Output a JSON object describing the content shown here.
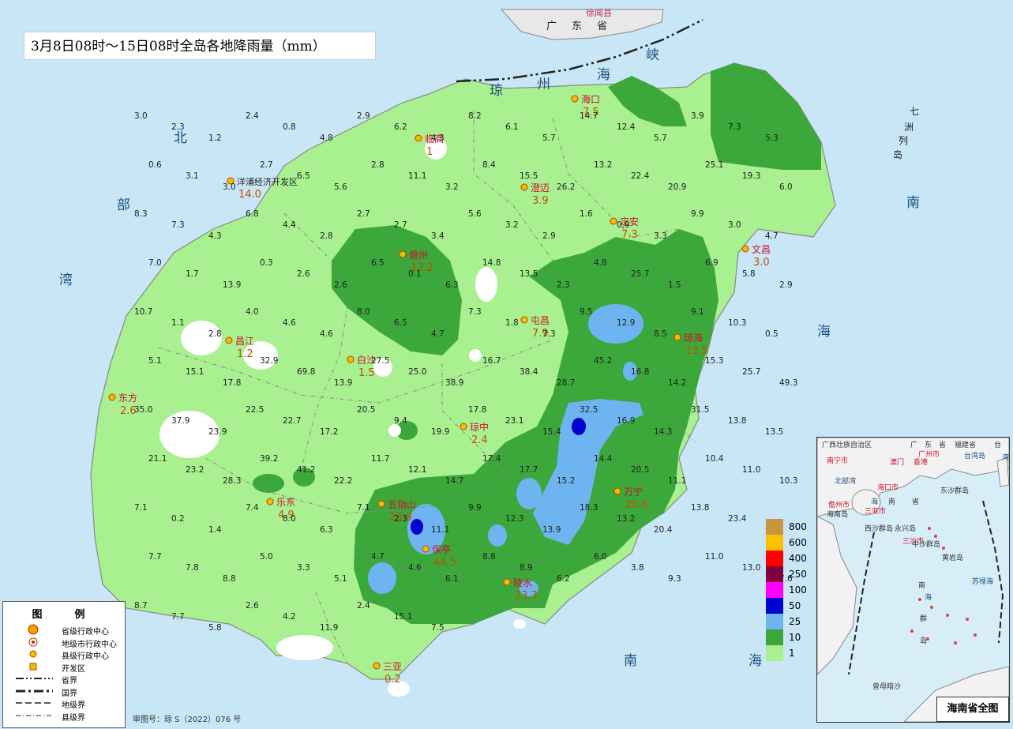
{
  "title": "3月8日08时～15日08时全岛各地降雨量（mm）",
  "approval": "审图号：琼 S（2022）076 号",
  "legend": {
    "title": "图　例",
    "items": [
      {
        "label": "省级行政中心",
        "symbol": "star-circle"
      },
      {
        "label": "地级市行政中心",
        "symbol": "double-circle"
      },
      {
        "label": "县级行政中心",
        "symbol": "dot-circle"
      },
      {
        "label": "开发区",
        "symbol": "square"
      },
      {
        "label": "省界",
        "symbol": "line-dashdot2"
      },
      {
        "label": "国界",
        "symbol": "line-thick"
      },
      {
        "label": "地级界",
        "symbol": "line-dash"
      },
      {
        "label": "县级界",
        "symbol": "line-dashdot"
      }
    ]
  },
  "color_scale": [
    {
      "label": "800",
      "color": "#c8963c"
    },
    {
      "label": "600",
      "color": "#ffc000"
    },
    {
      "label": "400",
      "color": "#ff0000"
    },
    {
      "label": "250",
      "color": "#800040"
    },
    {
      "label": "100",
      "color": "#ff00ff"
    },
    {
      "label": "50",
      "color": "#0000d0"
    },
    {
      "label": "25",
      "color": "#6eb4f0"
    },
    {
      "label": "10",
      "color": "#3ca83c"
    },
    {
      "label": "1",
      "color": "#a8f090"
    }
  ],
  "sea_labels": [
    "北",
    "部",
    "湾",
    "海",
    "南",
    "海",
    "南",
    "琼",
    "州",
    "海",
    "峡",
    "七",
    "洲",
    "列",
    "岛",
    "广",
    "东",
    "省",
    "徐闻县"
  ],
  "stations": [
    {
      "name": "海口",
      "value": "7.5"
    },
    {
      "name": "临高",
      "value": "1"
    },
    {
      "name": "澄迈",
      "value": "3.9"
    },
    {
      "name": "定安",
      "value": "7.3"
    },
    {
      "name": "文昌",
      "value": "3.0"
    },
    {
      "name": "儋州",
      "value": "17.2"
    },
    {
      "name": "洋浦经济开发区",
      "value": "14.0"
    },
    {
      "name": "昌江",
      "value": "1.2"
    },
    {
      "name": "白沙",
      "value": "1.5"
    },
    {
      "name": "屯昌",
      "value": "7.9"
    },
    {
      "name": "琼海",
      "value": "13.5"
    },
    {
      "name": "东方",
      "value": "2.6"
    },
    {
      "name": "琼中",
      "value": "2.4"
    },
    {
      "name": "乐东",
      "value": "4.9"
    },
    {
      "name": "五指山",
      "value": "23.8"
    },
    {
      "name": "万宁",
      "value": "20.6"
    },
    {
      "name": "保亭",
      "value": "44.5"
    },
    {
      "name": "陵水",
      "value": "23.3"
    },
    {
      "name": "三亚",
      "value": "0.2"
    }
  ],
  "point_values": [
    "3.0",
    "2.3",
    "1.2",
    "2.4",
    "0.8",
    "4.8",
    "2.9",
    "6.2",
    "4.3",
    "8.2",
    "6.1",
    "5.7",
    "14.7",
    "12.4",
    "5.7",
    "3.9",
    "7.3",
    "5.3",
    "0.6",
    "3.1",
    "3.0",
    "2.7",
    "6.5",
    "5.6",
    "2.8",
    "11.1",
    "3.2",
    "8.4",
    "15.5",
    "26.2",
    "13.2",
    "22.4",
    "20.9",
    "25.1",
    "19.3",
    "6.0",
    "8.3",
    "7.3",
    "4.3",
    "6.8",
    "4.4",
    "2.8",
    "2.7",
    "2.7",
    "3.4",
    "5.6",
    "3.2",
    "2.9",
    "1.6",
    "0.9",
    "3.3",
    "9.9",
    "3.0",
    "4.7",
    "7.0",
    "1.7",
    "13.9",
    "0.3",
    "2.6",
    "2.6",
    "6.5",
    "0.1",
    "6.3",
    "14.8",
    "13.5",
    "2.3",
    "4.8",
    "25.7",
    "1.5",
    "6.9",
    "5.8",
    "2.9",
    "10.7",
    "1.1",
    "2.8",
    "4.0",
    "4.6",
    "4.6",
    "8.0",
    "6.5",
    "4.7",
    "7.3",
    "1.8",
    "7.3",
    "9.5",
    "12.9",
    "8.5",
    "9.1",
    "10.3",
    "0.5",
    "5.1",
    "15.1",
    "17.8",
    "32.9",
    "69.8",
    "13.9",
    "27.5",
    "25.0",
    "38.9",
    "16.7",
    "38.4",
    "28.7",
    "45.2",
    "16.8",
    "14.2",
    "15.3",
    "25.7",
    "49.3",
    "35.0",
    "37.9",
    "23.9",
    "22.5",
    "22.7",
    "17.2",
    "20.5",
    "9.4",
    "19.9",
    "17.8",
    "23.1",
    "15.4",
    "32.5",
    "16.9",
    "14.3",
    "31.5",
    "13.8",
    "13.5",
    "21.1",
    "23.2",
    "28.3",
    "39.2",
    "41.2",
    "22.2",
    "11.7",
    "12.1",
    "14.7",
    "17.4",
    "17.7",
    "15.2",
    "14.4",
    "20.5",
    "11.1",
    "10.4",
    "11.0",
    "10.3",
    "7.1",
    "0.2",
    "1.4",
    "7.4",
    "8.0",
    "6.3",
    "7.1",
    "2.3",
    "11.1",
    "9.9",
    "12.3",
    "13.9",
    "18.3",
    "13.2",
    "20.4",
    "13.8",
    "23.4",
    "9.4",
    "7.7",
    "7.8",
    "8.8",
    "5.0",
    "3.3",
    "5.1",
    "4.7",
    "4.6",
    "6.1",
    "8.8",
    "8.9",
    "6.2",
    "6.0",
    "3.8",
    "9.3",
    "11.0",
    "13.0",
    "7.6",
    "8.7",
    "7.7",
    "5.8",
    "2.6",
    "4.2",
    "11.9",
    "2.4",
    "15.1",
    "7.5"
  ],
  "inset": {
    "title": "海南省全图",
    "labels": [
      "广西壮族自治区",
      "广",
      "东",
      "省",
      "福建省",
      "台",
      "湾",
      "南宁市",
      "广州市",
      "澳门",
      "香港",
      "台湾岛",
      "东沙群岛",
      "北部湾",
      "海口市",
      "儋州市",
      "三亚市",
      "海",
      "南",
      "省",
      "海南岛",
      "西沙群岛",
      "永兴岛",
      "三沙市",
      "中沙群岛",
      "黄岩岛",
      "南",
      "海",
      "群",
      "岛",
      "苏禄海",
      "曾母暗沙"
    ]
  }
}
